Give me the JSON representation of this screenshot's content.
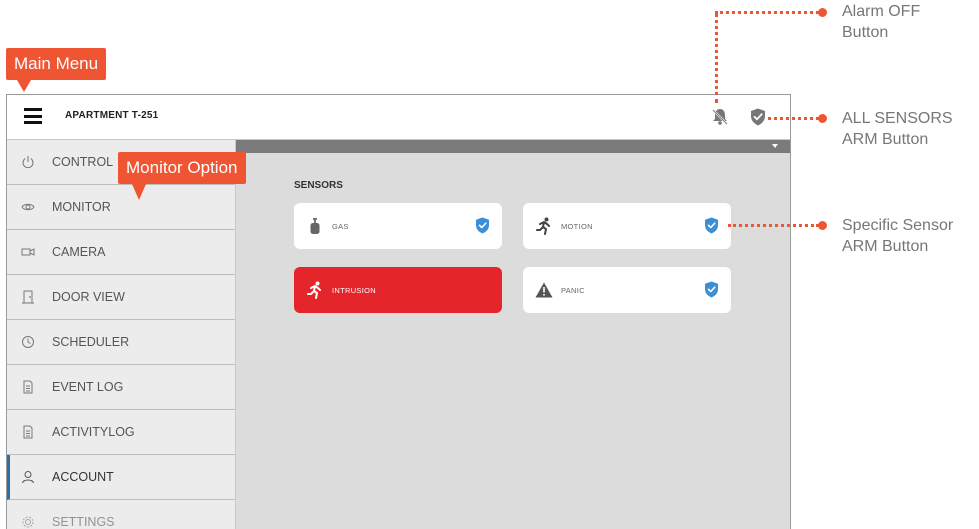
{
  "app": {
    "title": "APARTMENT T-251"
  },
  "sidebar": {
    "items": [
      {
        "label": "CONTROL",
        "icon": "power-icon"
      },
      {
        "label": "MONITOR",
        "icon": "eye-icon"
      },
      {
        "label": "CAMERA",
        "icon": "camera-icon"
      },
      {
        "label": "DOOR VIEW",
        "icon": "door-icon"
      },
      {
        "label": "SCHEDULER",
        "icon": "clock-icon"
      },
      {
        "label": "EVENT LOG",
        "icon": "document-icon"
      },
      {
        "label": "ACTIVITYLOG",
        "icon": "document-icon"
      },
      {
        "label": "ACCOUNT",
        "icon": "user-icon"
      },
      {
        "label": "SETTINGS",
        "icon": "gear-icon"
      }
    ]
  },
  "content": {
    "section_title": "SENSORS",
    "sensors": [
      {
        "label": "GAS",
        "icon": "gas-cylinder-icon",
        "armed": true,
        "alert": false
      },
      {
        "label": "MOTION",
        "icon": "running-person-icon",
        "armed": true,
        "alert": false
      },
      {
        "label": "INTRUSION",
        "icon": "running-person-icon",
        "armed": false,
        "alert": true
      },
      {
        "label": "PANIC",
        "icon": "warning-icon",
        "armed": true,
        "alert": false
      }
    ]
  },
  "annotations": {
    "main_menu": "Main Menu",
    "monitor_option": "Monitor Option",
    "alarm_off": [
      "Alarm OFF",
      "Button"
    ],
    "all_sensors": [
      "ALL SENSORS",
      "ARM Button"
    ],
    "specific_sensor": [
      "Specific Sensor",
      "ARM Button"
    ]
  },
  "colors": {
    "accent": "#ef5433",
    "alert": "#e4252a",
    "shield_blue": "#3a8fd6",
    "active_nav": "#2d6ea3"
  }
}
